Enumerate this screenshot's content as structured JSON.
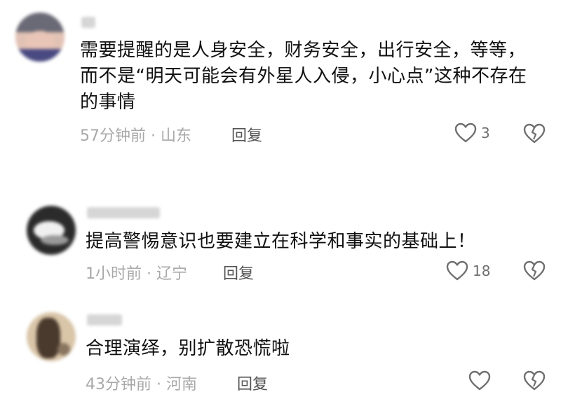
{
  "comments": [
    {
      "text": "需要提醒的是人身安全，财务安全，出行安全，等等，而不是“明天可能会有外星人入侵，小心点”这种不存在的事情",
      "time": "57分钟前",
      "location": "山东",
      "reply_label": "回复",
      "like_count": "3",
      "avatar_colors": [
        "#6a6a76",
        "#e8c5b6",
        "#4a4a82"
      ]
    },
    {
      "text": "提高警惕意识也要建立在科学和事实的基础上！",
      "time": "1小时前",
      "location": "辽宁",
      "reply_label": "回复",
      "like_count": "18",
      "avatar_colors": [
        "#2b2b2b",
        "#f0f0f0",
        "#9a9a9a"
      ]
    },
    {
      "text": "合理演绎，别扩散恐慌啦",
      "time": "43分钟前",
      "location": "河南",
      "reply_label": "回复",
      "like_count": "",
      "avatar_colors": [
        "#d9c5a8",
        "#4a3a2e",
        "#8a7560"
      ]
    }
  ],
  "meta_separator": "·",
  "icons": {
    "like": "heart-icon",
    "dislike": "broken-heart-icon"
  },
  "colors": {
    "text": "#111111",
    "meta": "#a8a8a8",
    "icon": "#6f6f6f"
  }
}
